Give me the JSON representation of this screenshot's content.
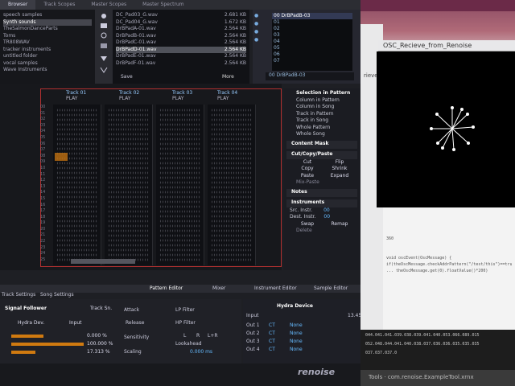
{
  "renoise": {
    "top_tabs": [
      "Browser",
      "Track Scopes",
      "Master Scopes",
      "Master Spectrum"
    ],
    "folders": [
      "speech samples",
      "Synth sounds",
      "TheSalmonDanceParts",
      "Toms",
      "TR808WAV",
      "tracker instruments",
      "untitled folder",
      "vocal samples",
      "Wave Instruments"
    ],
    "files": [
      {
        "name": "DC_Pad03_G.wav",
        "size": "2.681 KB"
      },
      {
        "name": "DC_Pad04_G.wav",
        "size": "1.672 KB"
      },
      {
        "name": "DrBPadA-01.wav",
        "size": "2.564 KB"
      },
      {
        "name": "DrBPadB-01.wav",
        "size": "2.564 KB"
      },
      {
        "name": "DrBPadC-01.wav",
        "size": "2.564 KB"
      },
      {
        "name": "DrBPadD-01.wav",
        "size": "2.564 KB"
      },
      {
        "name": "DrBPadE-01.wav",
        "size": "2.564 KB"
      },
      {
        "name": "DrBPadF-01.wav",
        "size": "2.564 KB"
      }
    ],
    "file_buttons": {
      "save": "Save",
      "more": "More"
    },
    "instrument_slot": "00 DrBPadB-03",
    "instrument_items": [
      "00 DrBPadB-03",
      "01",
      "02",
      "03",
      "04",
      "05",
      "06",
      "07"
    ],
    "instrument_footer": "00 DrBPadB-03",
    "tracks": [
      {
        "name": "Track 01",
        "state": "PLAY"
      },
      {
        "name": "Track 02",
        "state": "PLAY"
      },
      {
        "name": "Track 03",
        "state": "PLAY"
      },
      {
        "name": "Track 04",
        "state": "PLAY"
      }
    ],
    "line_numbers": [
      "00",
      "01",
      "02",
      "03",
      "04",
      "05",
      "06",
      "07",
      "08",
      "09",
      "10",
      "11",
      "12",
      "13",
      "14",
      "15",
      "16",
      "17",
      "18",
      "19",
      "20",
      "21",
      "22",
      "23",
      "24",
      "25"
    ],
    "menu": {
      "selection_header": "Selection in Pattern",
      "selection_items": [
        "Column in Pattern",
        "Column in Song",
        "Track in Pattern",
        "Track in Song",
        "Whole Pattern",
        "Whole Song"
      ],
      "content_mask": "Content Mask",
      "cut_copy_paste": "Cut/Copy/Paste",
      "ccp_buttons": [
        "Cut",
        "Flip",
        "Copy",
        "Shrink",
        "Paste",
        "Expand"
      ],
      "mix_paste": "Mix-Paste",
      "notes": "Notes",
      "instruments": "Instruments",
      "src_instr": "Src. Instr.",
      "src_val": "00",
      "dest_instr": "Dest. Instr.",
      "dest_val": "00",
      "swap": "Swap",
      "remap": "Remap",
      "delete": "Delete"
    },
    "editor_tabs": [
      "Pattern Editor",
      "Mixer",
      "Instrument Editor",
      "Sample Editor"
    ],
    "low_tabs": [
      "Track Settings",
      "Song Settings"
    ],
    "signal_follower": {
      "title": "Signal Follower",
      "track": "Track Sn.",
      "device": "Hydra Dev.",
      "input": "Input",
      "v1": "0.000 %",
      "v2": "100.000 %",
      "v3": "17.313 %"
    },
    "attack_panel": {
      "attack": "Attack",
      "release": "Release",
      "sensitivity": "Sensitivity",
      "scaling": "Scaling",
      "lp": "LP Filter",
      "hp": "HP Filter",
      "l": "L",
      "r": "R",
      "lr": "L+R",
      "lookahead": "Lookahead",
      "lookahead_val": "0.000 ms"
    },
    "hydra": {
      "title": "Hydra Device",
      "input_label": "Input",
      "outs": [
        {
          "label": "Out 1",
          "mode": "CT",
          "value": "None"
        },
        {
          "label": "Out 2",
          "mode": "CT",
          "value": "None"
        },
        {
          "label": "Out 3",
          "mode": "CT",
          "value": "None"
        },
        {
          "label": "Out 4",
          "mode": "CT",
          "value": "None"
        }
      ],
      "num": "13.45"
    },
    "logo": "renoise"
  },
  "desktop": {
    "osc_title": "OSC_Recieve_from_Renoise",
    "editor_fragment": "rieve",
    "code_lines": [
      "",
      "",
      "",
      "",
      "360",
      "",
      "",
      "void oscEvent(OscMessage) {",
      "  if(theOscMessage.checkAddrPattern(\"/test/this\")==true) {",
      "    ... theOscMessage.get(0).floatValue()*200)",
      "",
      ""
    ],
    "console_lines": [
      "044.041.041.039.038.039.041.040.053.066.089.015",
      "052.048.044.041.040.038.037.036.036.035.035.035",
      "037.037.037.0"
    ],
    "taskbar": "Tools · com.renoise.ExampleTool.xrnx"
  },
  "colors": {
    "accent": "#d07a10",
    "border_red": "#b23030"
  }
}
